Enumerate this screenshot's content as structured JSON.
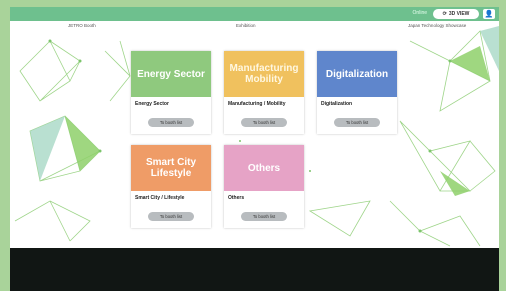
{
  "topbar": {
    "status_text": "Online",
    "view_button_label": "3D VIEW",
    "view_icon": "refresh-icon",
    "user_icon": "user-icon"
  },
  "headers": {
    "left": "JETRO Booth",
    "center": "Exhibition",
    "right": "Japan Technology Showcase"
  },
  "cards": [
    {
      "title": "Energy Sector",
      "caption": "Energy Sector",
      "button": "To booth list",
      "color": "#8fc97e"
    },
    {
      "title": "Manufacturing Mobility",
      "caption": "Manufacturing / Mobility",
      "button": "To booth list",
      "color": "#f0c15e"
    },
    {
      "title": "Digitalization",
      "caption": "Digitalization",
      "button": "To booth list",
      "color": "#5f86cc"
    },
    {
      "title": "Smart City Lifestyle",
      "caption": "Smart City / Lifestyle",
      "button": "To booth list",
      "color": "#ef9c67"
    },
    {
      "title": "Others",
      "caption": "Others",
      "button": "To booth list",
      "color": "#e6a3c6"
    }
  ],
  "colors": {
    "accent": "#6ec08e",
    "network_lines": "#9fd58a",
    "network_fill": "#8ed06a"
  }
}
